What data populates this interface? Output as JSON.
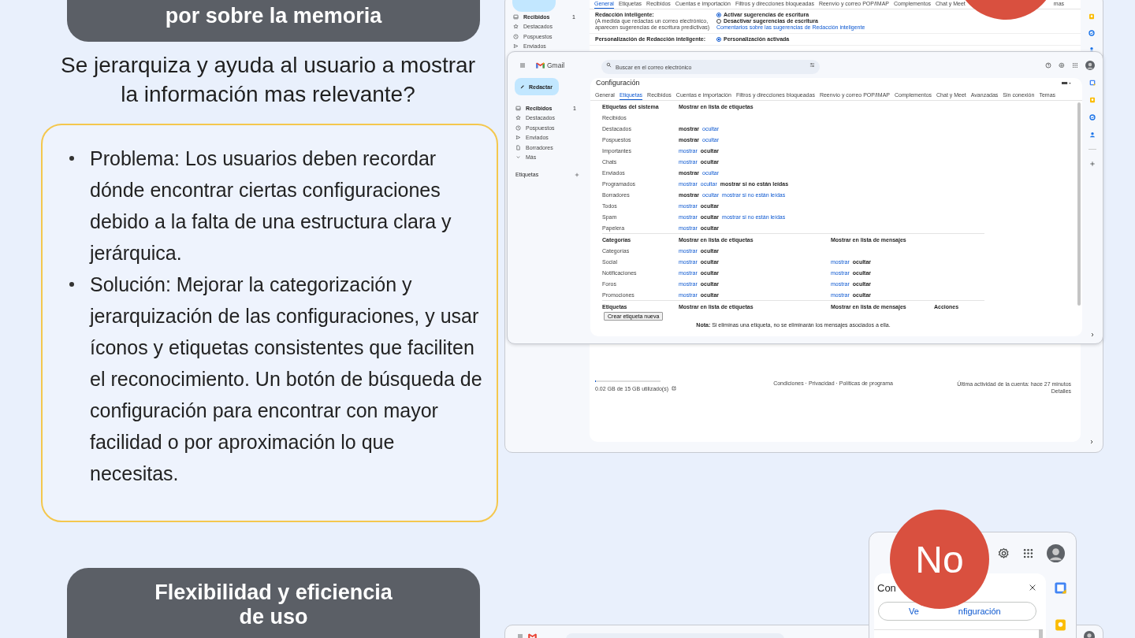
{
  "top_banner": {
    "title": "por sobre la memoria"
  },
  "question": "Se jerarquiza y ayuda al usuario a mostrar la información mas relevante?",
  "card": {
    "items": [
      {
        "text": "Problema: Los usuarios deben recordar dónde encontrar ciertas configuraciones debido a la falta de una estructura clara y jerárquica."
      },
      {
        "text": "Solución: Mejorar la categorización y jerarquización de las configuraciones, y usar íconos y etiquetas consistentes que faciliten el reconocimiento. Un botón de búsqueda de configuración para encontrar con mayor facilidad o por aproximación lo que necesitas."
      }
    ]
  },
  "bottom_banner": {
    "lines": [
      "Flexibilidad y eficiencia",
      "de uso"
    ]
  },
  "general_window": {
    "nav": [
      {
        "kind": "inbox",
        "label": "Recibidos",
        "count": "1",
        "selected": true
      },
      {
        "kind": "star",
        "label": "Destacados",
        "selected": false
      },
      {
        "kind": "clock",
        "label": "Pospuestos",
        "selected": false
      },
      {
        "kind": "send",
        "label": "Enviados",
        "selected": false
      }
    ],
    "tabs": [
      {
        "label": "General",
        "selected": true
      },
      {
        "label": "Etiquetas",
        "selected": false
      },
      {
        "label": "Recibidos",
        "selected": false
      },
      {
        "label": "Cuentas e importación",
        "selected": false
      },
      {
        "label": "Filtros y direcciones bloqueadas",
        "selected": false
      },
      {
        "label": "Reenvío y correo POP/IMAP",
        "selected": false
      },
      {
        "label": "Complementos",
        "selected": false
      },
      {
        "label": "Chat y Meet",
        "selected": false
      },
      {
        "label": "mas",
        "selected": false
      }
    ],
    "settings": [
      {
        "label": "Redacción inteligente:",
        "hint": "(A medida que redactas un correo electrónico, aparecen sugerencias de escritura predictivas)",
        "options": [
          {
            "label": "Activar sugerencias de escritura",
            "selected": true
          },
          {
            "label": "Desactivar sugerencias de escritura",
            "selected": false
          }
        ],
        "link": "Comentarios sobre las sugerencias de Redacción inteligente"
      },
      {
        "label": "Personalización de Redacción inteligente:",
        "options": [
          {
            "label": "Personalización activada",
            "selected": true
          }
        ]
      }
    ],
    "storage": {
      "level": 0.0013,
      "text": "0.02 GB de 15 GB utilizado(s)"
    },
    "footer_links": "Condiciones · Privacidad · Políticas de programa",
    "activity": "Última actividad de la cuenta: hace 27 minutos",
    "details": "Detalles"
  },
  "labels_window": {
    "brand": "Gmail",
    "search": {
      "placeholder": "Buscar en el correo electrónico"
    },
    "compose": "Redactar",
    "nav": [
      {
        "kind": "inbox",
        "label": "Recibidos",
        "count": "1",
        "selected": true
      },
      {
        "kind": "star",
        "label": "Destacados",
        "selected": false
      },
      {
        "kind": "clock",
        "label": "Pospuestos",
        "selected": false
      },
      {
        "kind": "send",
        "label": "Enviados",
        "selected": false
      },
      {
        "kind": "draft",
        "label": "Borradores",
        "selected": false
      },
      {
        "kind": "more",
        "label": "Más",
        "selected": false
      }
    ],
    "labels_heading": "Etiquetas",
    "title": "Configuración",
    "tabs": [
      {
        "label": "General",
        "selected": false
      },
      {
        "label": "Etiquetas",
        "selected": true
      },
      {
        "label": "Recibidos",
        "selected": false
      },
      {
        "label": "Cuentas e importación",
        "selected": false
      },
      {
        "label": "Filtros y direcciones bloqueadas",
        "selected": false
      },
      {
        "label": "Reenvío y correo POP/IMAP",
        "selected": false
      },
      {
        "label": "Complementos",
        "selected": false
      },
      {
        "label": "Chat y Meet",
        "selected": false
      },
      {
        "label": "Avanzadas",
        "selected": false
      },
      {
        "label": "Sin conexión",
        "selected": false
      },
      {
        "label": "Temas",
        "selected": false
      }
    ],
    "sections": [
      {
        "columns": [
          "Etiquetas del sistema",
          "Mostrar en lista de etiquetas"
        ],
        "rows": [
          {
            "label": "Recibidos"
          },
          {
            "label": "Destacados",
            "label_list": [
              {
                "text": "mostrar",
                "selected": true
              },
              {
                "text": "ocultar",
                "selected": false
              }
            ]
          },
          {
            "label": "Pospuestos",
            "label_list": [
              {
                "text": "mostrar",
                "selected": true
              },
              {
                "text": "ocultar",
                "selected": false
              }
            ]
          },
          {
            "label": "Importantes",
            "label_list": [
              {
                "text": "mostrar",
                "selected": false
              },
              {
                "text": "ocultar",
                "selected": true
              }
            ]
          },
          {
            "label": "Chats",
            "label_list": [
              {
                "text": "mostrar",
                "selected": false
              },
              {
                "text": "ocultar",
                "selected": true
              }
            ]
          },
          {
            "label": "Enviados",
            "label_list": [
              {
                "text": "mostrar",
                "selected": true
              },
              {
                "text": "ocultar",
                "selected": false
              }
            ]
          },
          {
            "label": "Programados",
            "label_list": [
              {
                "text": "mostrar",
                "selected": false
              },
              {
                "text": "ocultar",
                "selected": false
              },
              {
                "text": "mostrar si no están leídas",
                "selected": true
              }
            ]
          },
          {
            "label": "Borradores",
            "label_list": [
              {
                "text": "mostrar",
                "selected": true
              },
              {
                "text": "ocultar",
                "selected": false
              },
              {
                "text": "mostrar si no están leídas",
                "selected": false
              }
            ]
          },
          {
            "label": "Todos",
            "label_list": [
              {
                "text": "mostrar",
                "selected": false
              },
              {
                "text": "ocultar",
                "selected": true
              }
            ]
          },
          {
            "label": "Spam",
            "label_list": [
              {
                "text": "mostrar",
                "selected": false
              },
              {
                "text": "ocultar",
                "selected": true
              },
              {
                "text": "mostrar si no están leídas",
                "selected": false
              }
            ]
          },
          {
            "label": "Papelera",
            "label_list": [
              {
                "text": "mostrar",
                "selected": false
              },
              {
                "text": "ocultar",
                "selected": true
              }
            ]
          }
        ]
      },
      {
        "columns": [
          "Categorías",
          "Mostrar en lista de etiquetas",
          "Mostrar en lista de mensajes"
        ],
        "rows": [
          {
            "label": "Categorías",
            "label_list": [
              {
                "text": "mostrar",
                "selected": false
              },
              {
                "text": "ocultar",
                "selected": true
              }
            ]
          },
          {
            "label": "Social",
            "label_list": [
              {
                "text": "mostrar",
                "selected": false
              },
              {
                "text": "ocultar",
                "selected": true
              }
            ],
            "message_list": [
              {
                "text": "mostrar",
                "selected": false
              },
              {
                "text": "ocultar",
                "selected": true
              }
            ]
          },
          {
            "label": "Notificaciones",
            "label_list": [
              {
                "text": "mostrar",
                "selected": false
              },
              {
                "text": "ocultar",
                "selected": true
              }
            ],
            "message_list": [
              {
                "text": "mostrar",
                "selected": false
              },
              {
                "text": "ocultar",
                "selected": true
              }
            ]
          },
          {
            "label": "Foros",
            "label_list": [
              {
                "text": "mostrar",
                "selected": false
              },
              {
                "text": "ocultar",
                "selected": true
              }
            ],
            "message_list": [
              {
                "text": "mostrar",
                "selected": false
              },
              {
                "text": "ocultar",
                "selected": true
              }
            ]
          },
          {
            "label": "Promociones",
            "label_list": [
              {
                "text": "mostrar",
                "selected": false
              },
              {
                "text": "ocultar",
                "selected": true
              }
            ],
            "message_list": [
              {
                "text": "mostrar",
                "selected": false
              },
              {
                "text": "ocultar",
                "selected": true
              }
            ]
          }
        ]
      },
      {
        "columns": [
          "Etiquetas",
          "Mostrar en lista de etiquetas",
          "Mostrar en lista de mensajes",
          "Acciones"
        ]
      }
    ],
    "create_button": "Crear etiqueta nueva",
    "note": "**Nota:** Si eliminas una etiqueta, no se eliminarán los mensajes asociados a ella."
  },
  "quick_settings_window": {
    "title": "Con",
    "button_parts": [
      "Ve",
      "nfiguración"
    ],
    "badge": "No"
  }
}
